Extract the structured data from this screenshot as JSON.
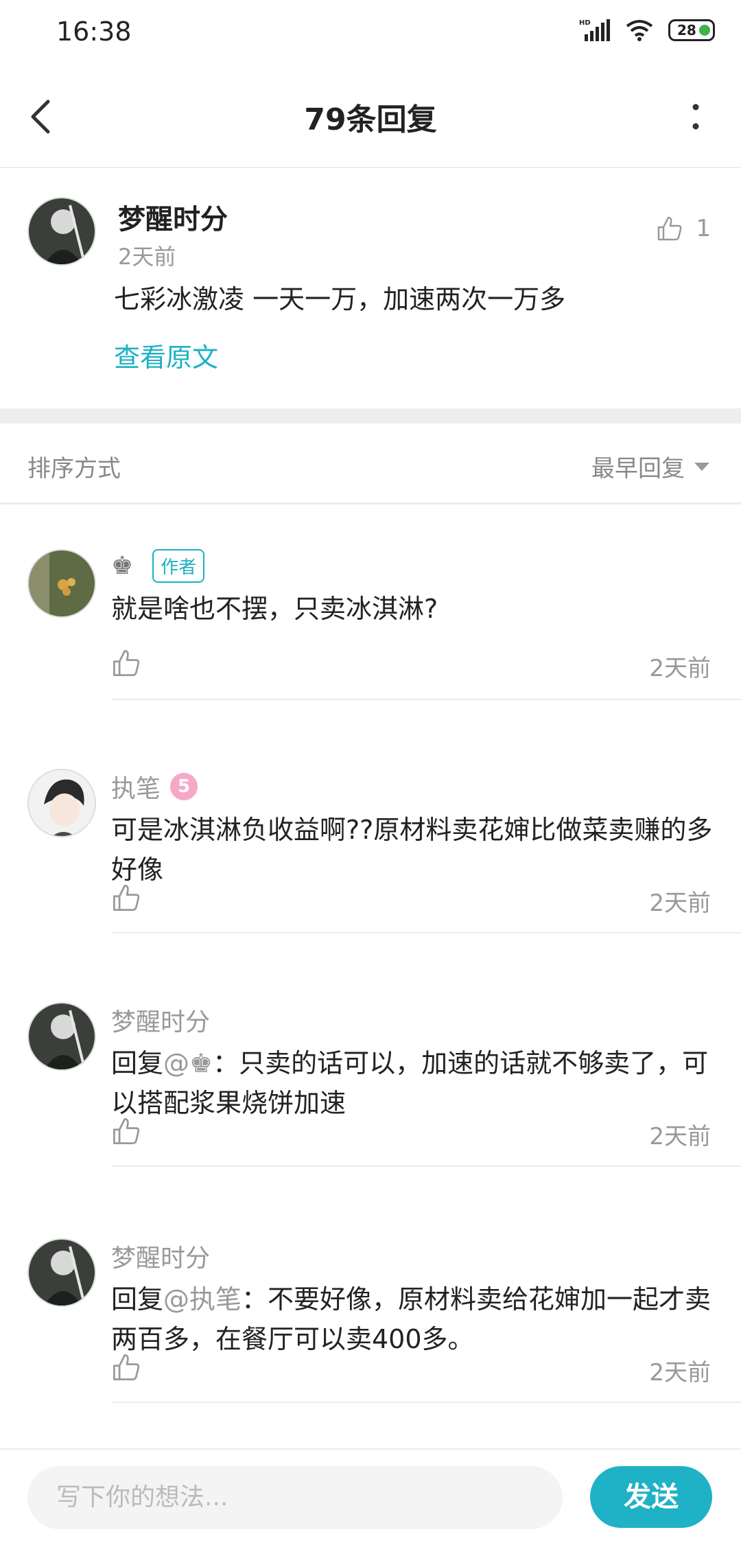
{
  "status_bar": {
    "time": "16:38",
    "battery": "28",
    "signal_label": "HD"
  },
  "header": {
    "title": "79条回复",
    "back_icon": "chevron-left-icon",
    "more_icon": "more-vertical-icon"
  },
  "original_comment": {
    "username": "梦醒时分",
    "time": "2天前",
    "like_count": "1",
    "content": "七彩冰激凌 一天一万，加速两次一万多",
    "view_original": "查看原文"
  },
  "sort": {
    "label": "排序方式",
    "value": "最早回复"
  },
  "replies": [
    {
      "username": "",
      "crown": "♚",
      "author_tag": "作者",
      "text": "就是啥也不摆，只卖冰淇淋?",
      "time": "2天前"
    },
    {
      "username": "执笔",
      "level": "5",
      "text": "可是冰淇淋负收益啊??原材料卖花婶比做菜卖赚的多好像",
      "time": "2天前"
    },
    {
      "username": "梦醒时分",
      "reply_prefix": "回复",
      "mention": "@♚",
      "text": "：只卖的话可以，加速的话就不够卖了，可以搭配浆果烧饼加速",
      "time": "2天前"
    },
    {
      "username": "梦醒时分",
      "reply_prefix": "回复",
      "mention": "@执笔",
      "text": "：不要好像，原材料卖给花婶加一起才卖两百多，在餐厅可以卖400多。",
      "time": "2天前"
    }
  ],
  "bottom_bar": {
    "input_placeholder": "写下你的想法...",
    "send_label": "发送"
  },
  "colors": {
    "accent": "#1bb1c4",
    "send_button": "#1fb1c5",
    "muted_text": "#999999"
  }
}
